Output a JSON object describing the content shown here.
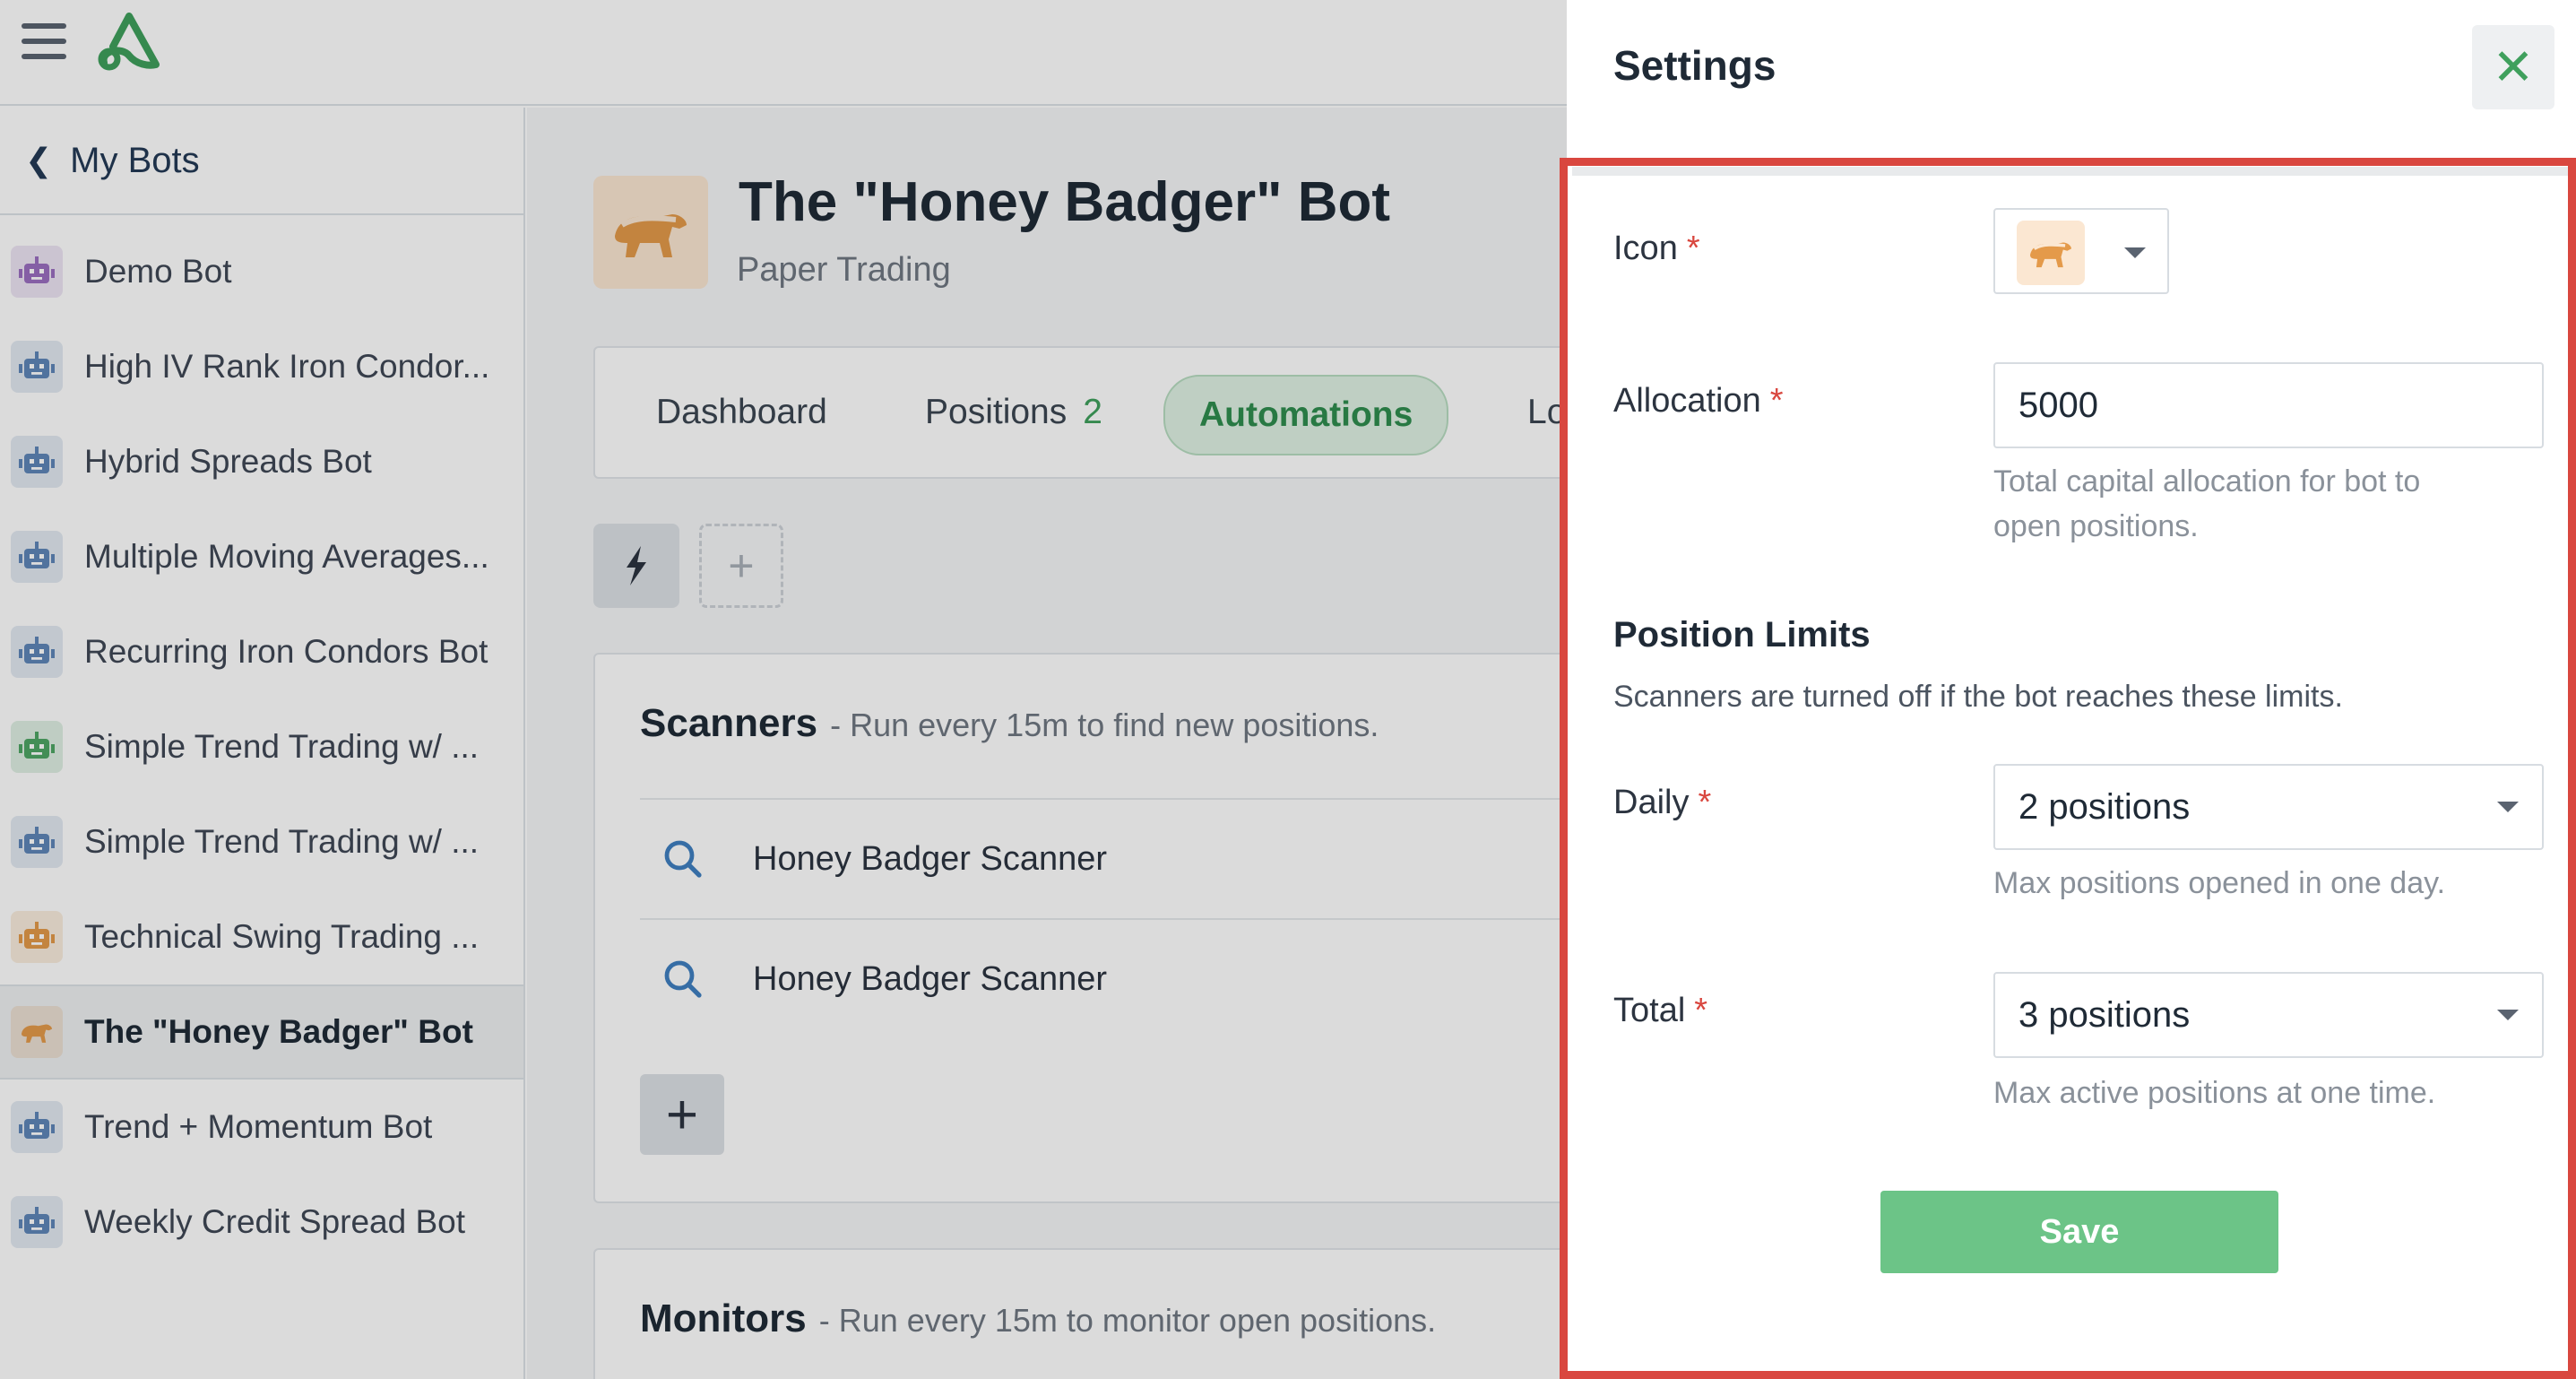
{
  "sidebar": {
    "back_label": "My Bots",
    "bots": [
      {
        "name": "Demo Bot",
        "color": "#9b6fc1"
      },
      {
        "name": "High IV Rank Iron Condor...",
        "color": "#5f86b8"
      },
      {
        "name": "Hybrid Spreads Bot",
        "color": "#5f86b8"
      },
      {
        "name": "Multiple Moving Averages...",
        "color": "#5f86b8"
      },
      {
        "name": "Recurring Iron Condors Bot",
        "color": "#5f86b8"
      },
      {
        "name": "Simple Trend Trading w/ ...",
        "color": "#4fa665"
      },
      {
        "name": "Simple Trend Trading w/ ...",
        "color": "#5f86b8"
      },
      {
        "name": "Technical Swing Trading ...",
        "color": "#e49a4a"
      },
      {
        "name": "The \"Honey Badger\" Bot",
        "color": "#e49a4a"
      },
      {
        "name": "Trend + Momentum Bot",
        "color": "#5f86b8"
      },
      {
        "name": "Weekly Credit Spread Bot",
        "color": "#5f86b8"
      }
    ]
  },
  "bot": {
    "title": "The \"Honey Badger\" Bot",
    "subtitle": "Paper Trading"
  },
  "tabs": {
    "dashboard": "Dashboard",
    "positions": "Positions",
    "positions_count": "2",
    "automations": "Automations",
    "logs_partial": "Lo"
  },
  "scanners": {
    "title": "Scanners",
    "desc": "- Run every 15m to find new positions.",
    "items": [
      "Honey Badger Scanner",
      "Honey Badger Scanner"
    ]
  },
  "monitors": {
    "title": "Monitors",
    "desc": "- Run every 15m to monitor open positions."
  },
  "settings": {
    "title": "Settings",
    "icon_label": "Icon",
    "allocation_label": "Allocation",
    "allocation_value": "5000",
    "allocation_hint_1": "Total capital allocation for bot to",
    "allocation_hint_2": "open positions.",
    "limits_title": "Position Limits",
    "limits_desc": "Scanners are turned off if the bot reaches these limits.",
    "daily_label": "Daily",
    "daily_value": "2 positions",
    "daily_hint": "Max positions opened in one day.",
    "total_label": "Total",
    "total_value": "3 positions",
    "total_hint": "Max active positions at one time.",
    "save_label": "Save",
    "required_mark": "*"
  },
  "colors": {
    "accent_green": "#3fa05d",
    "save_green": "#6cc487",
    "highlight_red": "#d9473f",
    "badger_orange": "#e49a4a"
  }
}
